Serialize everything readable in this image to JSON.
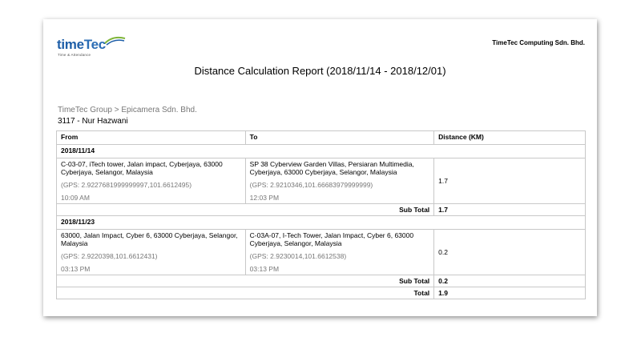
{
  "header": {
    "logo_text_main": "time",
    "logo_text_tec": "Tec",
    "logo_tagline": "Time & Attendance",
    "company": "TimeTec Computing Sdn. Bhd.",
    "title": "Distance Calculation Report (2018/11/14 - 2018/12/01)"
  },
  "breadcrumb": "TimeTec Group > Epicamera Sdn. Bhd.",
  "employee": "3117 - Nur Hazwani",
  "table": {
    "headers": [
      "From",
      "To",
      "Distance (KM)"
    ],
    "groups": [
      {
        "date": "2018/11/14",
        "rows": [
          {
            "from_address": "C-03-07, iTech tower, Jalan impact, Cyberjaya, 63000 Cyberjaya, Selangor, Malaysia",
            "from_gps": "(GPS: 2.9227681999999997,101.6612495)",
            "from_time": "10:09 AM",
            "to_address": "SP 38 Cyberview Garden Villas, Persiaran Multimedia, Cyberjaya, 63000 Cyberjaya, Selangor, Malaysia",
            "to_gps": "(GPS: 2.9210346,101.66683979999999)",
            "to_time": "12:03 PM",
            "distance": "1.7"
          }
        ],
        "subtotal_label": "Sub Total",
        "subtotal": "1.7"
      },
      {
        "date": "2018/11/23",
        "rows": [
          {
            "from_address": "63000, Jalan Impact, Cyber 6, 63000 Cyberjaya, Selangor, Malaysia",
            "from_gps": "(GPS: 2.9220398,101.6612431)",
            "from_time": "03:13 PM",
            "to_address": "C-03A-07, I-Tech Tower, Jalan Impact, Cyber 6, 63000 Cyberjaya, Selangor, Malaysia",
            "to_gps": "(GPS: 2.9230014,101.6612538)",
            "to_time": "03:13 PM",
            "distance": "0.2"
          }
        ],
        "subtotal_label": "Sub Total",
        "subtotal": "0.2"
      }
    ],
    "total_label": "Total",
    "total": "1.9"
  },
  "colors": {
    "logo_blue": "#1f5fa8",
    "muted_text": "#777777",
    "border": "#c8c8c8"
  }
}
